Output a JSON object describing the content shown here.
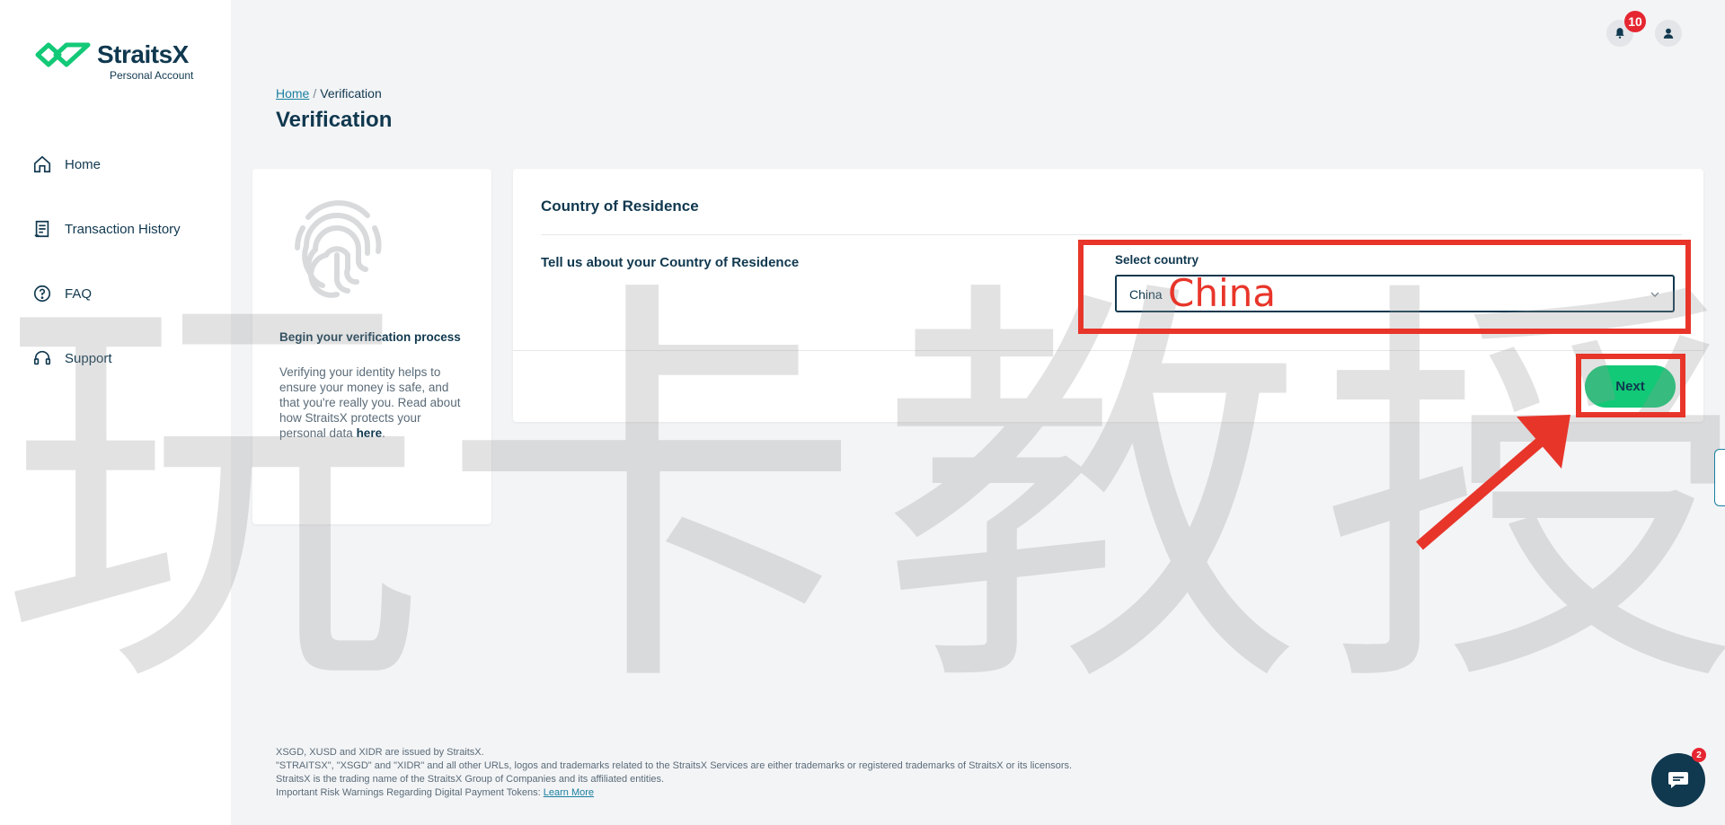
{
  "brand": {
    "name": "StraitsX",
    "subtitle": "Personal Account",
    "accent": "#12c977",
    "navy": "#10384f"
  },
  "sidebar": {
    "items": [
      {
        "label": "Home",
        "icon": "home-icon"
      },
      {
        "label": "Transaction History",
        "icon": "receipt-icon"
      },
      {
        "label": "FAQ",
        "icon": "help-circle-icon"
      },
      {
        "label": "Support",
        "icon": "headset-icon"
      }
    ]
  },
  "topbar": {
    "notification_count": "10"
  },
  "breadcrumb": {
    "home": "Home",
    "separator": "/",
    "current": "Verification"
  },
  "page": {
    "title": "Verification"
  },
  "info_card": {
    "title": "Begin your verification process",
    "text": "Verifying your identity helps to ensure your money is safe, and that you're really you. Read about how StraitsX protects your personal data ",
    "link": "here",
    "end": "."
  },
  "form": {
    "title": "Country of Residence",
    "question": "Tell us about your Country of Residence",
    "select_label": "Select country",
    "select_value": "China",
    "next_label": "Next"
  },
  "annotation": {
    "text": "China",
    "color": "#e8352a"
  },
  "watermark": {
    "text": "玩卡教授"
  },
  "footer": {
    "line1": "XSGD, XUSD and XIDR are issued by StraitsX.",
    "line2": "\"STRAITSX\", \"XSGD\" and \"XIDR\" and all other URLs, logos and trademarks related to the StraitsX Services are either trademarks or registered trademarks of StraitsX or its licensors.",
    "line3": "StraitsX is the trading name of the StraitsX Group of Companies and its affiliated entities.",
    "line4": "Important Risk Warnings Regarding Digital Payment Tokens: ",
    "link": "Learn More"
  },
  "chat": {
    "badge_count": "2"
  }
}
